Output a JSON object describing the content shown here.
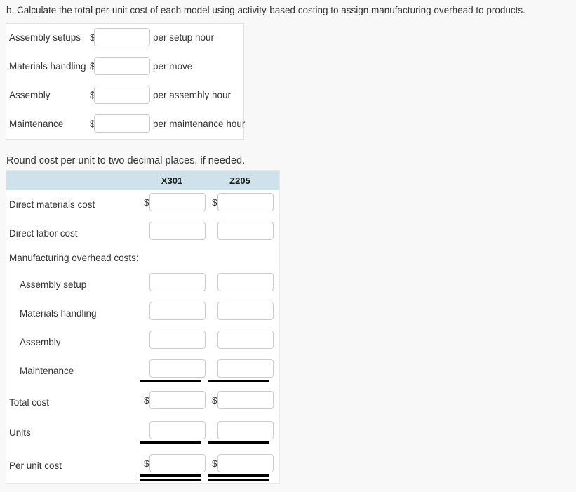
{
  "question": {
    "text": "b. Calculate the total per-unit cost of each model using activity-based costing to assign manufacturing overhead to products."
  },
  "rate_table": {
    "rows": [
      {
        "label": "Assembly setups",
        "currency": "$",
        "value": "",
        "suffix": "per setup hour"
      },
      {
        "label": "Materials handling",
        "currency": "$",
        "value": "",
        "suffix": "per move"
      },
      {
        "label": "Assembly",
        "currency": "$",
        "value": "",
        "suffix": "per assembly hour"
      },
      {
        "label": "Maintenance",
        "currency": "$",
        "value": "",
        "suffix": "per maintenance hour"
      }
    ]
  },
  "round_note": {
    "text": "Round cost per unit to two decimal places, if needed."
  },
  "cost_table": {
    "columns": [
      "X301",
      "Z205"
    ],
    "rows": [
      {
        "label": "Direct materials cost",
        "indent": false,
        "currency": "$",
        "x301": "",
        "z205": "",
        "rule": "none"
      },
      {
        "label": "Direct labor cost",
        "indent": false,
        "currency": "",
        "x301": "",
        "z205": "",
        "rule": "none"
      },
      {
        "label": "Manufacturing overhead costs:",
        "indent": false,
        "currency": "",
        "x301": null,
        "z205": null,
        "rule": "none"
      },
      {
        "label": "Assembly setup",
        "indent": true,
        "currency": "",
        "x301": "",
        "z205": "",
        "rule": "none"
      },
      {
        "label": "Materials handling",
        "indent": true,
        "currency": "",
        "x301": "",
        "z205": "",
        "rule": "none"
      },
      {
        "label": "Assembly",
        "indent": true,
        "currency": "",
        "x301": "",
        "z205": "",
        "rule": "none"
      },
      {
        "label": "Maintenance",
        "indent": true,
        "currency": "",
        "x301": "",
        "z205": "",
        "rule": "single"
      },
      {
        "label": "Total cost",
        "indent": false,
        "currency": "$",
        "x301": "",
        "z205": "",
        "rule": "none"
      },
      {
        "label": "Units",
        "indent": false,
        "currency": "",
        "x301": "",
        "z205": "",
        "rule": "single"
      },
      {
        "label": "Per unit cost",
        "indent": false,
        "currency": "$",
        "x301": "",
        "z205": "",
        "rule": "double"
      }
    ]
  },
  "colors": {
    "page_background": "#f8f8f8",
    "table_background": "#ffffff",
    "header_background": "#cfe2ec",
    "text": "#333333",
    "input_border": "#cccccc",
    "rule": "#000000"
  }
}
